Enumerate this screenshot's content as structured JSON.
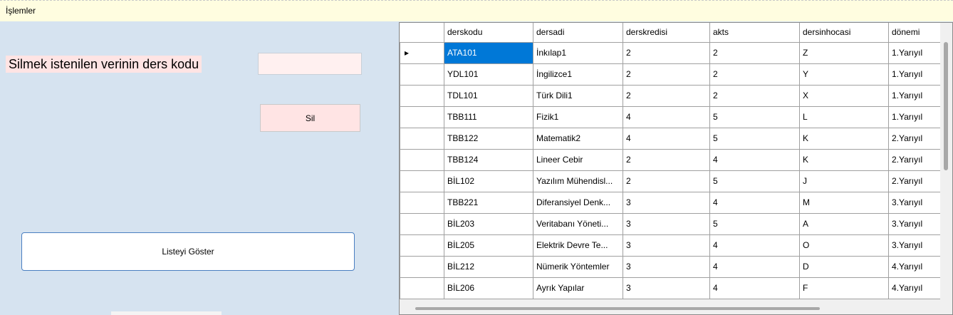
{
  "menu": {
    "items": [
      "İşlemler"
    ]
  },
  "form": {
    "delete_label": "Silmek istenilen verinin ders kodu",
    "code_input_value": "",
    "delete_button": "Sil",
    "list_button": "Listeyi Göster"
  },
  "grid": {
    "columns": [
      "derskodu",
      "dersadi",
      "derskredisi",
      "akts",
      "dersinhocasi",
      "dönemi"
    ],
    "current_row_marker": "▸",
    "rows": [
      [
        "ATA101",
        "İnkılap1",
        "2",
        "2",
        "Z",
        "1.Yarıyıl"
      ],
      [
        "YDL101",
        "İngilizce1",
        "2",
        "2",
        "Y",
        "1.Yarıyıl"
      ],
      [
        "TDL101",
        "Türk Dili1",
        "2",
        "2",
        "X",
        "1.Yarıyıl"
      ],
      [
        "TBB111",
        "Fizik1",
        "4",
        "5",
        "L",
        "1.Yarıyıl"
      ],
      [
        "TBB122",
        "Matematik2",
        "4",
        "5",
        "K",
        "2.Yarıyıl"
      ],
      [
        "TBB124",
        "Lineer Cebir",
        "2",
        "4",
        "K",
        "2.Yarıyıl"
      ],
      [
        "BİL102",
        "Yazılım Mühendisl...",
        "2",
        "5",
        "J",
        "2.Yarıyıl"
      ],
      [
        "TBB221",
        "Diferansiyel Denk...",
        "3",
        "4",
        "M",
        "3.Yarıyıl"
      ],
      [
        "BİL203",
        "Veritabanı Yöneti...",
        "3",
        "5",
        "A",
        "3.Yarıyıl"
      ],
      [
        "BİL205",
        "Elektrik Devre Te...",
        "3",
        "4",
        "O",
        "3.Yarıyıl"
      ],
      [
        "BİL212",
        "Nümerik Yöntemler",
        "3",
        "4",
        "D",
        "4.Yarıyıl"
      ],
      [
        "BİL206",
        "Ayrık Yapılar",
        "3",
        "4",
        "F",
        "4.Yarıyıl"
      ]
    ],
    "colors": {
      "selection": "#0078d7",
      "gridline": "#a0a0a0"
    }
  },
  "colors": {
    "background": "#d6e3f0",
    "menubar": "#fffde0",
    "pink": "#ffe4e4"
  }
}
